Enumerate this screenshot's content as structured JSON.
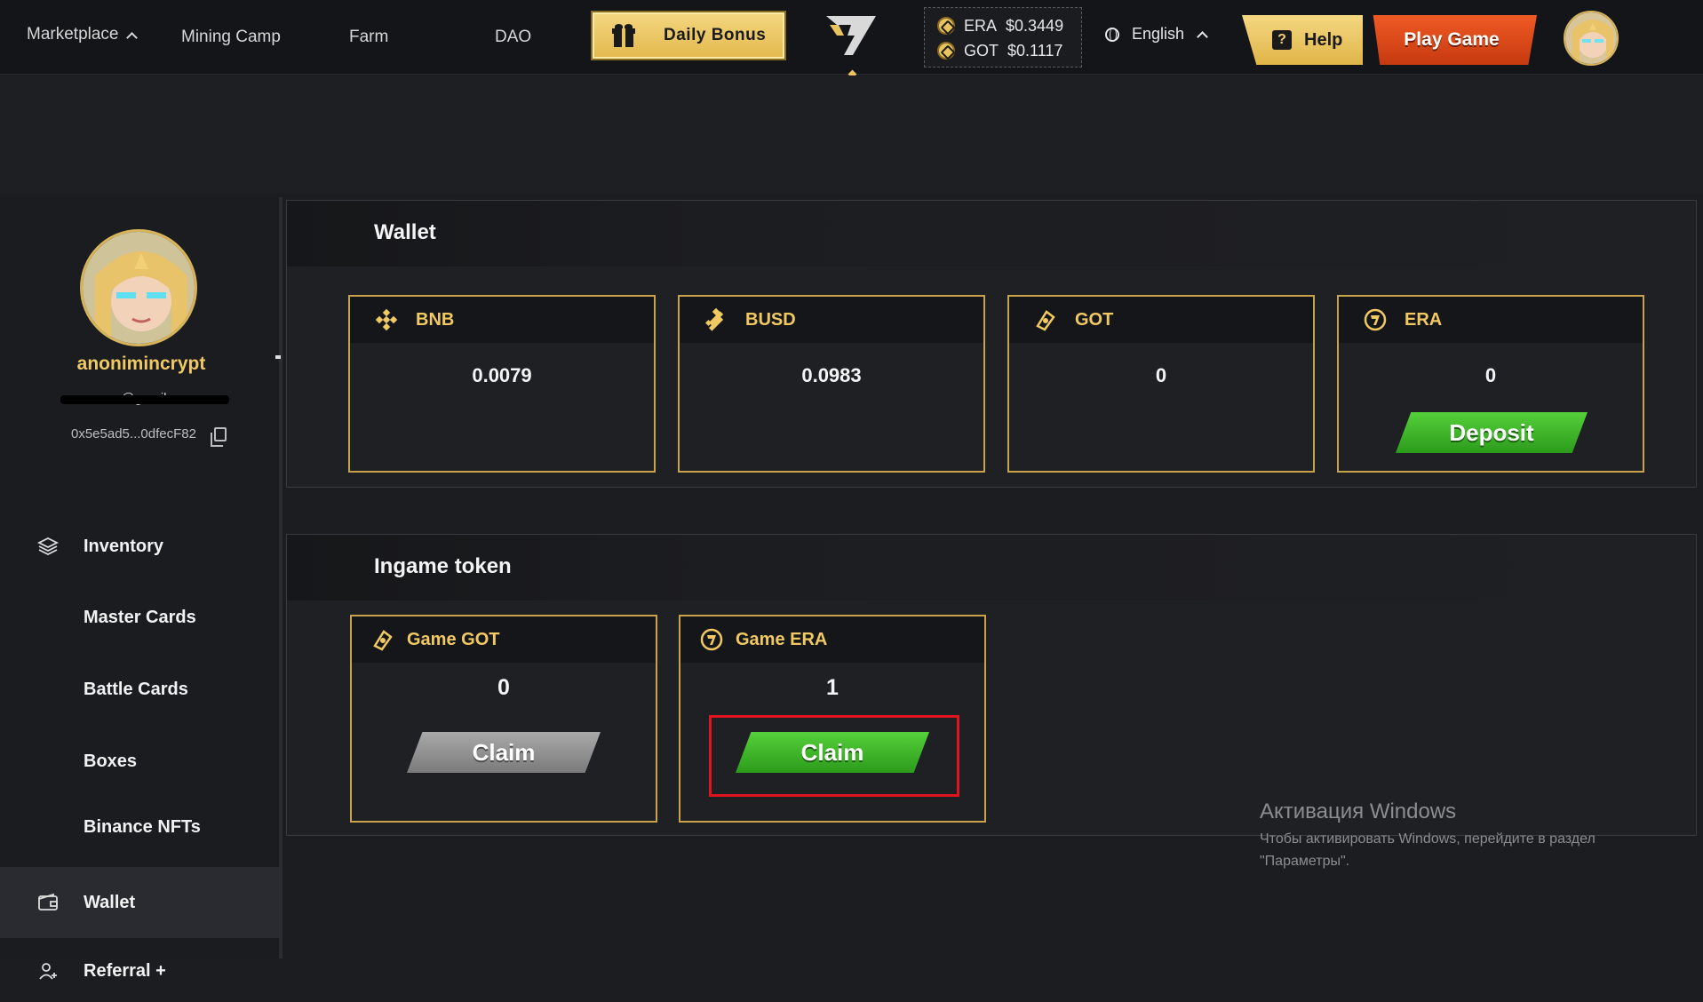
{
  "nav": {
    "marketplace": "Marketplace",
    "mining_camp": "Mining Camp",
    "farm": "Farm",
    "dao": "DAO",
    "daily_bonus": "Daily Bonus",
    "prices": [
      {
        "token": "ERA",
        "price": "$0.3449"
      },
      {
        "token": "GOT",
        "price": "$0.1117"
      }
    ],
    "language": "English",
    "help": "Help",
    "play_game": "Play Game"
  },
  "profile": {
    "username": "anonimincrypt",
    "email_visible": "@gmail.com",
    "address": "0x5e5ad5...0dfecF82"
  },
  "sidebar": {
    "items": [
      {
        "label": "Inventory",
        "icon": "layers-icon"
      },
      {
        "label": "Master Cards"
      },
      {
        "label": "Battle Cards"
      },
      {
        "label": "Boxes"
      },
      {
        "label": "Binance NFTs"
      },
      {
        "label": "Wallet",
        "icon": "wallet-icon",
        "active": true
      },
      {
        "label": "Referral +",
        "icon": "user-plus-icon"
      }
    ]
  },
  "wallet": {
    "title": "Wallet",
    "cards": [
      {
        "token": "BNB",
        "value": "0.0079",
        "icon": "bnb-icon"
      },
      {
        "token": "BUSD",
        "value": "0.0983",
        "icon": "busd-icon"
      },
      {
        "token": "GOT",
        "value": "0",
        "icon": "got-icon"
      },
      {
        "token": "ERA",
        "value": "0",
        "icon": "era-icon",
        "button": "Deposit"
      }
    ]
  },
  "ingame": {
    "title": "Ingame token",
    "cards": [
      {
        "token": "Game GOT",
        "value": "0",
        "button": "Claim",
        "enabled": false
      },
      {
        "token": "Game ERA",
        "value": "1",
        "button": "Claim",
        "enabled": true
      }
    ]
  },
  "watermark": {
    "title": "Активация Windows",
    "line1": "Чтобы активировать Windows, перейдите в раздел",
    "line2": "\"Параметры\"."
  },
  "colors": {
    "gold": "#c9a24c",
    "accent_yellow": "#f0c962",
    "green_button": "#3fb82a",
    "orange_button": "#e04c1a",
    "highlight_red": "#e0141e"
  }
}
